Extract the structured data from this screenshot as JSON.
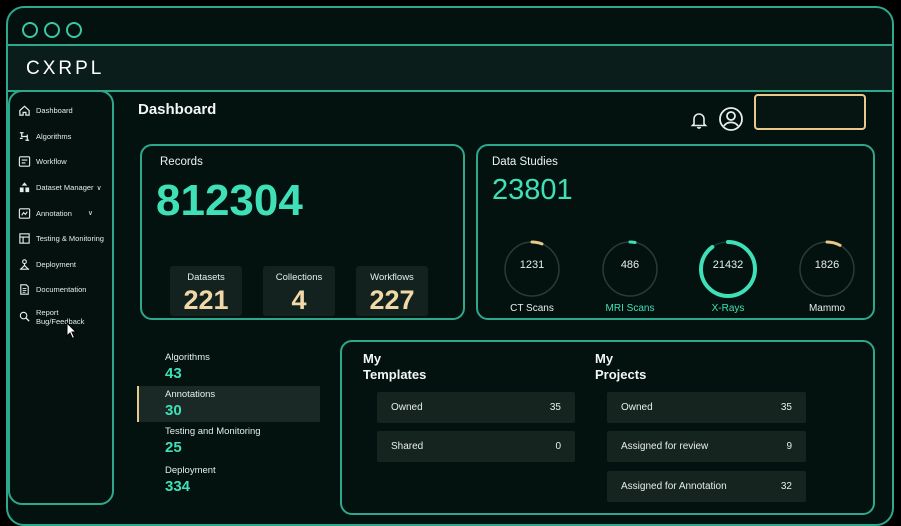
{
  "app": {
    "logo": "CXRPL"
  },
  "sidebar": {
    "items": [
      {
        "label": "Dashboard",
        "icon": "home-icon"
      },
      {
        "label": "Algorithms",
        "icon": "algorithm-icon"
      },
      {
        "label": "Workflow",
        "icon": "workflow-icon"
      },
      {
        "label": "Dataset Manager",
        "icon": "dataset-icon",
        "chevron": "∨"
      },
      {
        "label": "Annotation",
        "icon": "annotation-icon",
        "chevron": "∨"
      },
      {
        "label": "Testing & Monitoring",
        "icon": "testing-icon"
      },
      {
        "label": "Deployment",
        "icon": "deployment-icon"
      },
      {
        "label": "Documentation",
        "icon": "documentation-icon"
      },
      {
        "label_line1": "Report",
        "label_line2": "Bug/Feedback",
        "icon": "bug-report-icon"
      }
    ]
  },
  "header": {
    "title": "Dashboard"
  },
  "records": {
    "title": "Records",
    "total": "812304",
    "stats": [
      {
        "label": "Datasets",
        "value": "221"
      },
      {
        "label": "Collections",
        "value": "4"
      },
      {
        "label": "Workflows",
        "value": "227"
      }
    ]
  },
  "studies": {
    "title": "Data Studies",
    "total": "23801",
    "modalities": [
      {
        "label": "CT Scans",
        "value": "1231",
        "fraction": 0.06,
        "arc_color": "#e8c989",
        "label_teal": false
      },
      {
        "label": "MRI Scans",
        "value": "486",
        "fraction": 0.03,
        "arc_color": "#3fe0b7",
        "label_teal": true
      },
      {
        "label": "X-Rays",
        "value": "21432",
        "fraction": 0.9,
        "arc_color": "#3fe0b7",
        "label_teal": true
      },
      {
        "label": "Mammo",
        "value": "1826",
        "fraction": 0.08,
        "arc_color": "#e8c989",
        "label_teal": false
      }
    ]
  },
  "metrics": [
    {
      "label": "Algorithms",
      "value": "43"
    },
    {
      "label": "Annotations",
      "value": "30"
    },
    {
      "label": "Testing and Monitoring",
      "value": "25"
    },
    {
      "label": "Deployment",
      "value": "334"
    }
  ],
  "templates": {
    "title_line1": "My",
    "title_line2": "Templates",
    "rows": [
      {
        "label": "Owned",
        "value": "35"
      },
      {
        "label": "Shared",
        "value": "0"
      }
    ]
  },
  "projects": {
    "title_line1": "My",
    "title_line2": "Projects",
    "rows": [
      {
        "label": "Owned",
        "value": "35"
      },
      {
        "label": "Assigned for review",
        "value": "9"
      },
      {
        "label": "Assigned for Annotation",
        "value": "32"
      }
    ]
  },
  "colors": {
    "accent": "#3fe0b7",
    "border": "#2ea88c",
    "gold": "#e8c989",
    "background": "#03110f"
  }
}
